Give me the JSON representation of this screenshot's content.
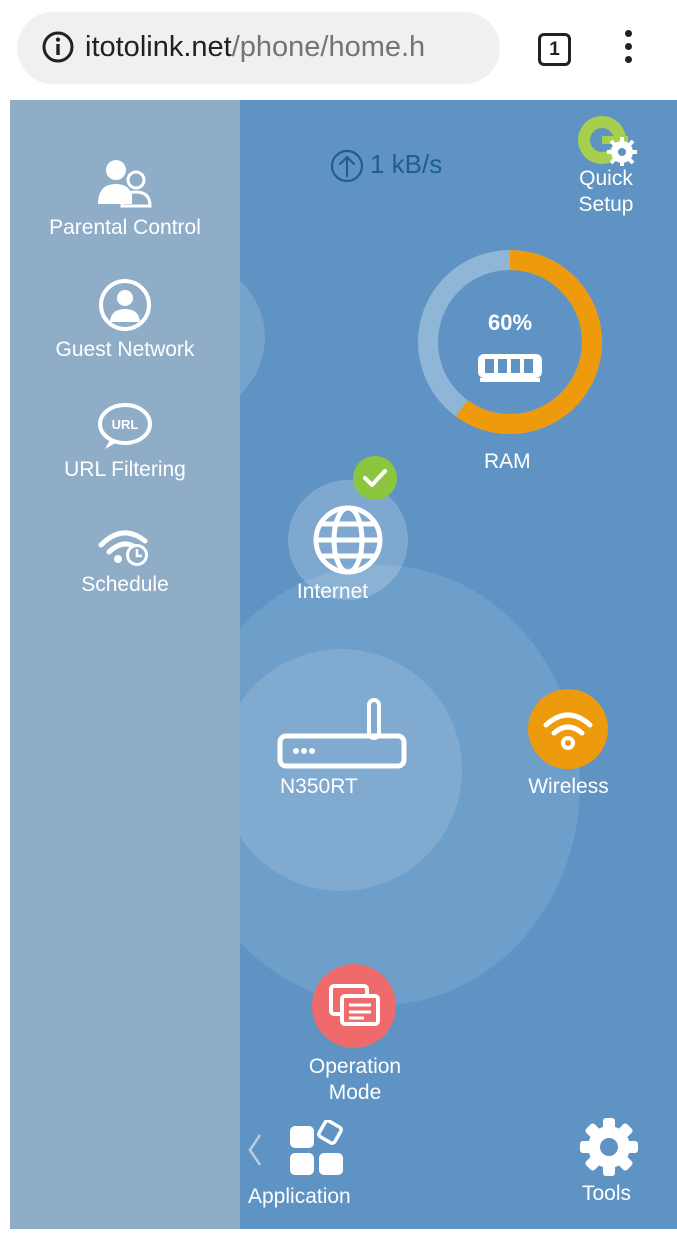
{
  "browser": {
    "url_domain": "itotolink.net",
    "url_path": "/phone/home.h",
    "tab_count": "1",
    "icons": {
      "info": "info-icon",
      "menu": "kebab-menu-icon"
    }
  },
  "sidebar": {
    "items": [
      {
        "label": "Parental Control",
        "icon": "parental-control-icon"
      },
      {
        "label": "Guest Network",
        "icon": "guest-network-icon"
      },
      {
        "label": "URL Filtering",
        "icon": "url-filtering-icon"
      },
      {
        "label": "Schedule",
        "icon": "schedule-icon"
      }
    ]
  },
  "status": {
    "upload_speed": "1 kB/s",
    "quick_setup_line1": "Quick",
    "quick_setup_line2": "Setup",
    "ram_percent_label": "60%",
    "ram_fraction": 0.6,
    "ram_label": "RAM"
  },
  "nodes": {
    "internet": "Internet",
    "device": "N350RT",
    "wireless": "Wireless",
    "operation_mode_line1": "Operation",
    "operation_mode_line2": "Mode"
  },
  "bottom_nav": {
    "application": "Application",
    "tools": "Tools"
  },
  "colors": {
    "app_background": "#5e93c4",
    "sidebar_background": "#90adc8",
    "ram_accent": "#ee9a0d",
    "wireless_accent": "#ee9a0d",
    "operation_mode_accent": "#ef6b6b",
    "status_ok": "#8cc63f",
    "speed_text": "#1e5f8e"
  }
}
